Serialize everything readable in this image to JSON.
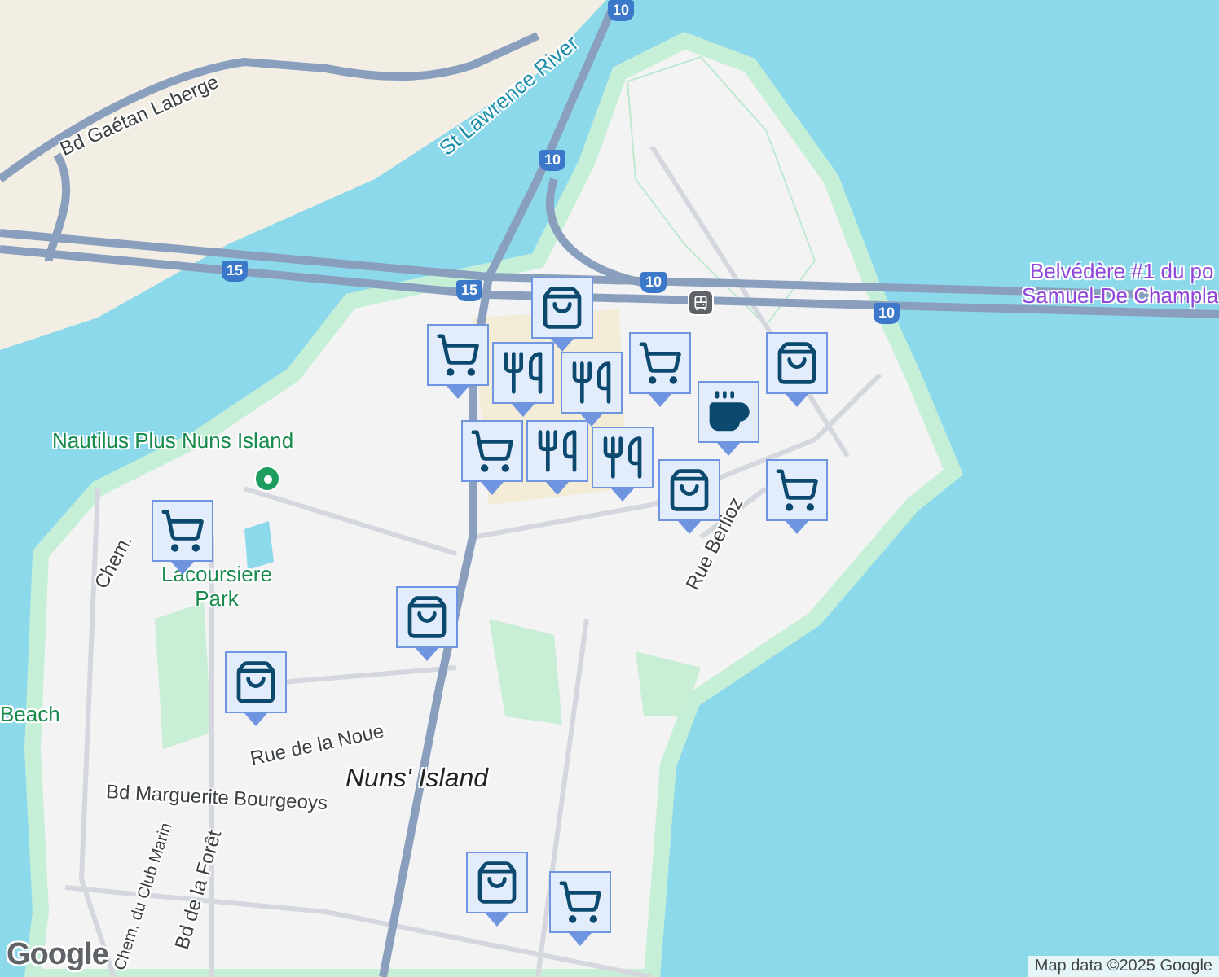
{
  "map": {
    "labels": [
      {
        "text": "Bd Gaétan Laberge",
        "kind": "road"
      },
      {
        "text": "St Lawrence River",
        "kind": "water"
      },
      {
        "text": "Belvédère #1 du po",
        "kind": "poi"
      },
      {
        "text": "Samuel-De Champla",
        "kind": "poi"
      },
      {
        "text": "Nautilus Plus Nuns Island",
        "kind": "park"
      },
      {
        "text": "Lacoursiere Park",
        "kind": "park"
      },
      {
        "text": "Beach",
        "kind": "park"
      },
      {
        "text": "Rue de la Noue",
        "kind": "road"
      },
      {
        "text": "Nuns' Island",
        "kind": "place"
      },
      {
        "text": "Bd Marguerite Bourgeoys",
        "kind": "road"
      },
      {
        "text": "Bd de la Forêt",
        "kind": "road"
      },
      {
        "text": "Chem. du Club Marin",
        "kind": "road"
      },
      {
        "text": "Rue Berlioz",
        "kind": "road"
      },
      {
        "text": "Chem.",
        "kind": "road"
      }
    ],
    "shields": [
      "10",
      "10",
      "10",
      "10",
      "15",
      "15"
    ],
    "pins": [
      {
        "kind": "bag"
      },
      {
        "kind": "cart"
      },
      {
        "kind": "food"
      },
      {
        "kind": "food"
      },
      {
        "kind": "cart"
      },
      {
        "kind": "cup"
      },
      {
        "kind": "bag"
      },
      {
        "kind": "cart"
      },
      {
        "kind": "food"
      },
      {
        "kind": "food"
      },
      {
        "kind": "bag"
      },
      {
        "kind": "cart"
      },
      {
        "kind": "cart"
      },
      {
        "kind": "bag"
      },
      {
        "kind": "bag"
      },
      {
        "kind": "bag"
      },
      {
        "kind": "cart"
      }
    ]
  },
  "attribution": "Map data ©2025 Google",
  "logo": "Google"
}
